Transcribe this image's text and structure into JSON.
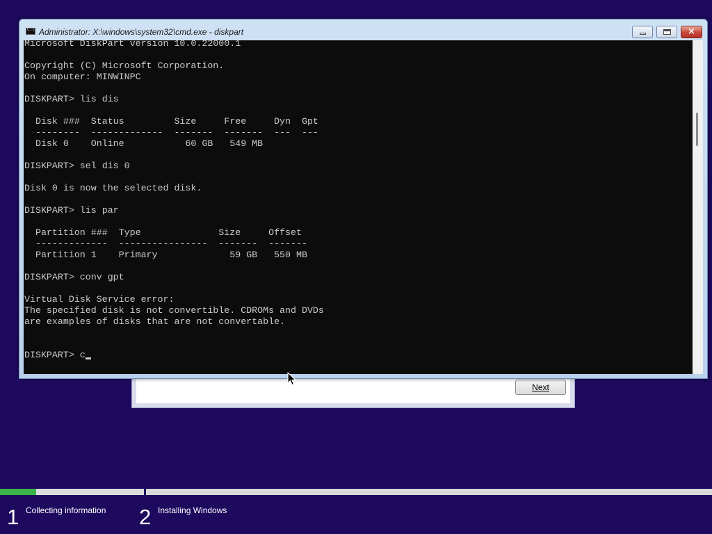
{
  "window": {
    "title": "Administrator: X:\\windows\\system32\\cmd.exe - diskpart",
    "minimize_label": "minimize",
    "maximize_label": "maximize",
    "close_label": "×"
  },
  "console": {
    "lines": [
      "Microsoft DiskPart version 10.0.22000.1",
      "",
      "Copyright (C) Microsoft Corporation.",
      "On computer: MINWINPC",
      "",
      "DISKPART> lis dis",
      "",
      "  Disk ###  Status         Size     Free     Dyn  Gpt",
      "  --------  -------------  -------  -------  ---  ---",
      "  Disk 0    Online           60 GB   549 MB",
      "",
      "DISKPART> sel dis 0",
      "",
      "Disk 0 is now the selected disk.",
      "",
      "DISKPART> lis par",
      "",
      "  Partition ###  Type              Size     Offset",
      "  -------------  ----------------  -------  -------",
      "  Partition 1    Primary             59 GB   550 MB",
      "",
      "DISKPART> conv gpt",
      "",
      "Virtual Disk Service error:",
      "The specified disk is not convertible. CDROMs and DVDs",
      "are examples of disks that are not convertable.",
      "",
      ""
    ],
    "prompt": "DISKPART> c"
  },
  "setup_dialog": {
    "next_button": "Next"
  },
  "progress": {
    "step1_fraction": 0.25
  },
  "steps": [
    {
      "number": "1",
      "label": "Collecting information"
    },
    {
      "number": "2",
      "label": "Installing Windows"
    }
  ],
  "colors": {
    "desktop_background": "#1d0a5e",
    "console_background": "#0c0c0c",
    "console_text": "#cccccc",
    "progress_fill": "#39b54a"
  }
}
